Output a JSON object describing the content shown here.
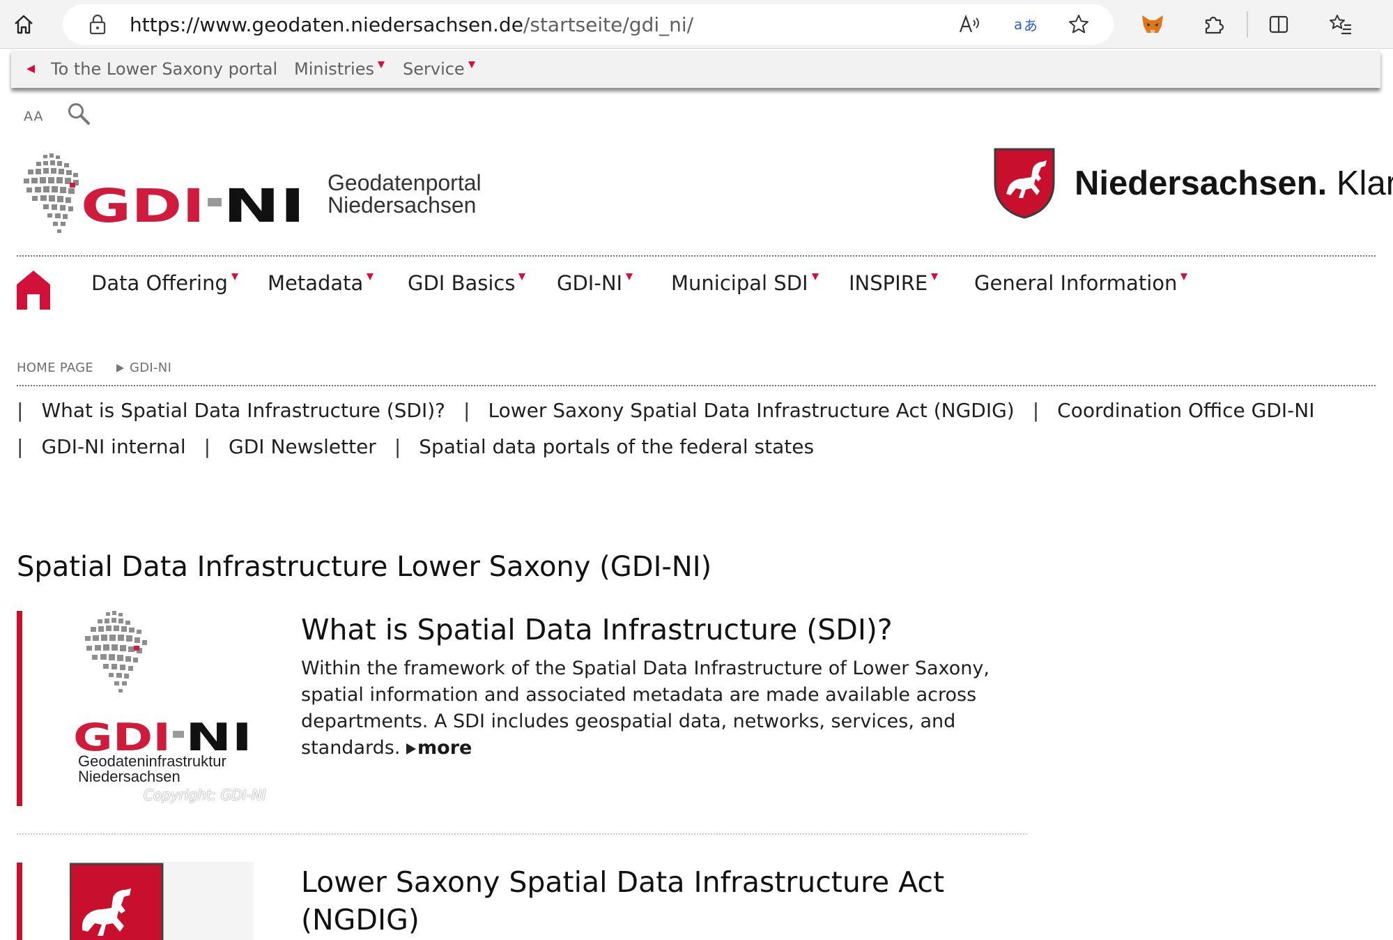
{
  "browser": {
    "url_domain": "https://www.geodaten.niedersachsen.de",
    "url_path": "/startseite/gdi_ni/"
  },
  "portal_bar": {
    "back_link": "To the Lower Saxony portal",
    "ministries": "Ministries",
    "service": "Service"
  },
  "tools": {
    "font_size_label": "AA"
  },
  "header": {
    "logo_text": "GDI-NI",
    "logo_subtitle_line1": "Geodatenportal",
    "logo_subtitle_line2": "Niedersachsen",
    "brand_bold": "Niedersachsen.",
    "brand_regular": "Klar."
  },
  "nav": {
    "items": [
      {
        "label": "Data Offering"
      },
      {
        "label": "Metadata"
      },
      {
        "label": "GDI Basics"
      },
      {
        "label": "GDI-NI"
      },
      {
        "label": "Municipal SDI"
      },
      {
        "label": "INSPIRE"
      },
      {
        "label": "General Information"
      }
    ]
  },
  "breadcrumb": {
    "home": "HOME PAGE",
    "current": "GDI-NI"
  },
  "subnav": {
    "row1": [
      {
        "label": "What is Spatial Data Infrastructure (SDI)?"
      },
      {
        "label": "Lower Saxony Spatial Data Infrastructure Act (NGDIG)"
      },
      {
        "label": "Coordination Office GDI-NI"
      }
    ],
    "row2": [
      {
        "label": "GDI-NI internal"
      },
      {
        "label": "GDI Newsletter"
      },
      {
        "label": "Spatial data portals of the federal states"
      }
    ]
  },
  "main": {
    "title": "Spatial Data Infrastructure Lower Saxony (GDI-NI)",
    "teasers": [
      {
        "title": "What is Spatial Data Infrastructure (SDI)?",
        "text": "Within the framework of the Spatial Data Infrastructure of Lower Saxony, spatial information and associated metadata are made available across departments. A SDI includes geospatial data, networks, services, and standards.",
        "more": "more",
        "image_logo": "GDI-NI",
        "image_caption_line1": "Geodateninfrastruktur",
        "image_caption_line2": "Niedersachsen",
        "copyright": "Copyright: GDI-NI"
      },
      {
        "title_line1": "Lower Saxony Spatial Data Infrastructure Act",
        "title_line2": "(NGDIG)"
      }
    ]
  },
  "colors": {
    "accent_red": "#c8102e",
    "nav_triangle": "#d1113a"
  }
}
